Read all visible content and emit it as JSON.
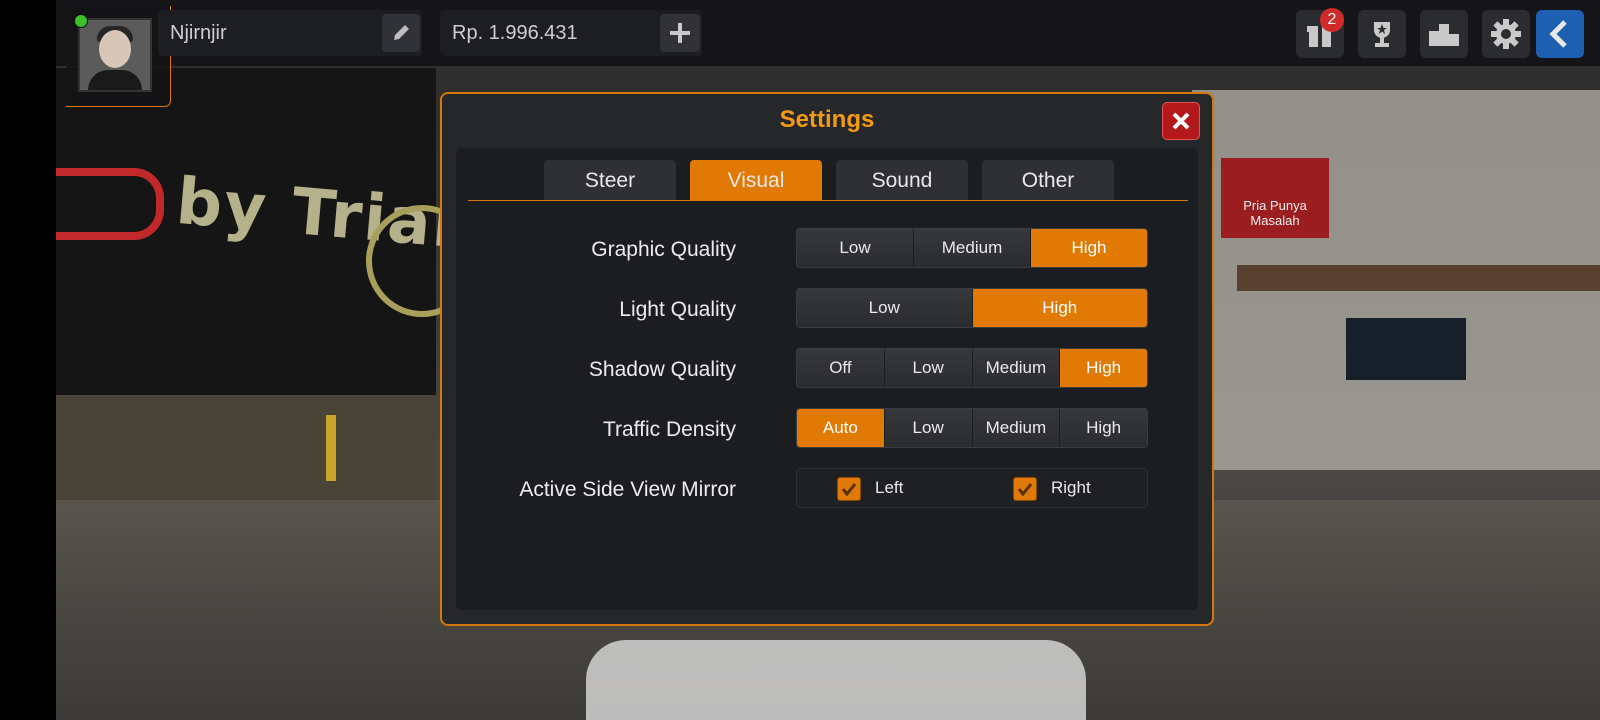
{
  "header": {
    "player_name": "Njirnjir",
    "money": "Rp. 1.996.431",
    "notification_count": "2"
  },
  "background": {
    "wall_text": "by Trian",
    "banner_text": "Pria Punya Masalah"
  },
  "settings": {
    "title": "Settings",
    "tabs": [
      {
        "label": "Steer",
        "active": false
      },
      {
        "label": "Visual",
        "active": true
      },
      {
        "label": "Sound",
        "active": false
      },
      {
        "label": "Other",
        "active": false
      }
    ],
    "rows": [
      {
        "label": "Graphic Quality",
        "options": [
          "Low",
          "Medium",
          "High"
        ],
        "selected": "High"
      },
      {
        "label": "Light Quality",
        "options": [
          "Low",
          "High"
        ],
        "selected": "High"
      },
      {
        "label": "Shadow Quality",
        "options": [
          "Off",
          "Low",
          "Medium",
          "High"
        ],
        "selected": "High"
      },
      {
        "label": "Traffic Density",
        "options": [
          "Auto",
          "Low",
          "Medium",
          "High"
        ],
        "selected": "Auto"
      }
    ],
    "mirror": {
      "label": "Active Side View Mirror",
      "left_label": "Left",
      "left_checked": true,
      "right_label": "Right",
      "right_checked": true
    }
  },
  "colors": {
    "accent": "#e07a04",
    "title": "#f39a12",
    "close": "#b3191b"
  }
}
